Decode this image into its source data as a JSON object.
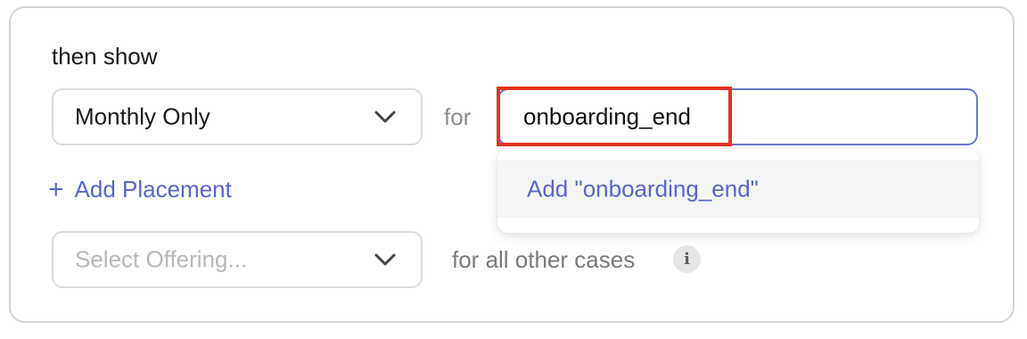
{
  "rule": {
    "heading": "then show",
    "offering_select": {
      "value": "Monthly Only"
    },
    "for_label": "for",
    "placement_input": {
      "value": "onboarding_end"
    },
    "dropdown": {
      "add_option": "Add \"onboarding_end\""
    },
    "add_placement": {
      "icon": "+",
      "label": "Add Placement"
    },
    "fallback": {
      "placeholder": "Select Offering...",
      "label": "for all other cases",
      "info_icon": "i"
    }
  },
  "colors": {
    "accent": "#5866c9",
    "input_focus_border": "#6a76d1",
    "highlight": "#e53422",
    "muted_text": "#8c8c8c",
    "placeholder": "#b8b8b8"
  }
}
